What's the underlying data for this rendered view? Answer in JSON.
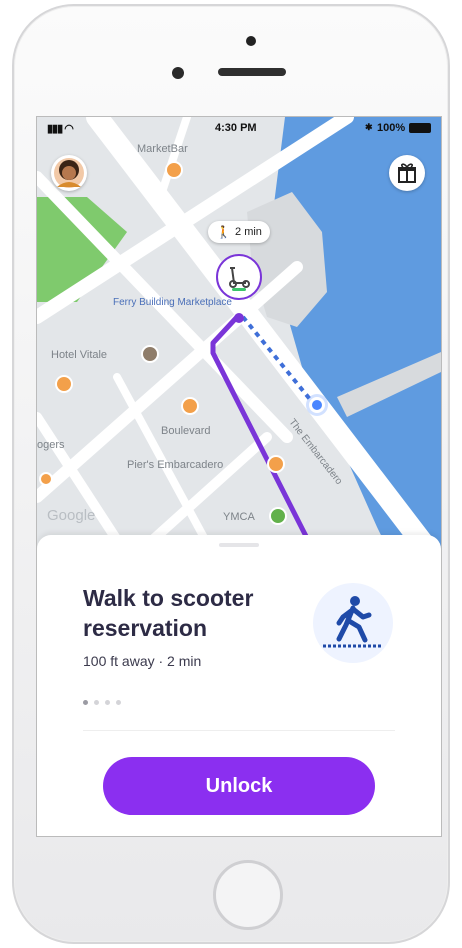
{
  "status_bar": {
    "time": "4:30 PM",
    "battery": "100%"
  },
  "map": {
    "labels": {
      "marketbar": "MarketBar",
      "ferry_building": "Ferry Building Marketplace",
      "hotel_vitale": "Hotel Vitale",
      "boulevard": "Boulevard",
      "piers_embarcadero": "Pier's Embarcadero",
      "ymca": "YMCA",
      "embarcadero": "The Embarcadero",
      "rogers": "ogers",
      "google": "Google"
    },
    "walk_time": "2 min"
  },
  "card": {
    "title": "Walk to scooter reservation",
    "subtitle": "100 ft away · 2 min",
    "unlock_label": "Unlock"
  },
  "icons": {
    "avatar": "user-avatar",
    "gift": "gift-icon",
    "walk": "walking-person-icon",
    "scooter": "scooter-icon"
  },
  "colors": {
    "accent": "#8b2ff0",
    "route": "#7a35d8",
    "water": "#5f9be0",
    "park": "#7fca6d",
    "location": "#4a86ff"
  }
}
